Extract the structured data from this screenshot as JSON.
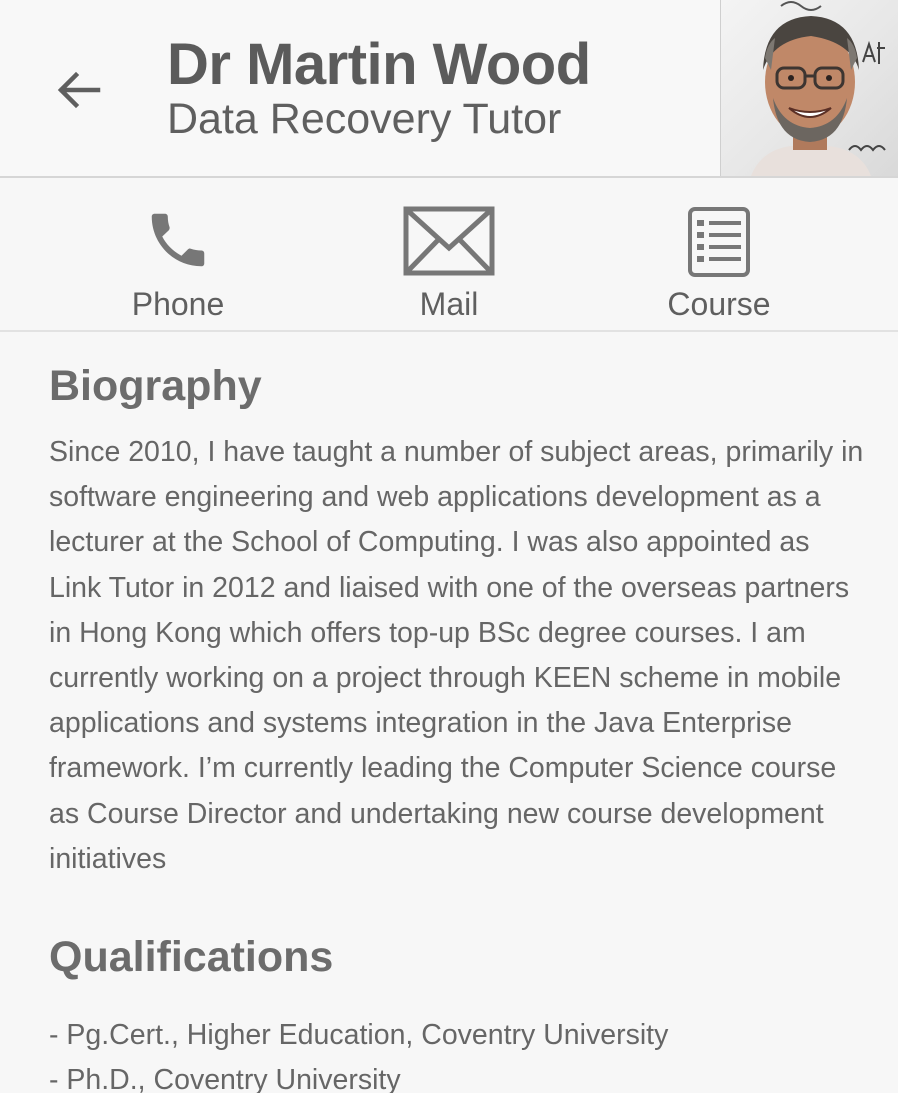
{
  "header": {
    "back_icon": "arrow-left-icon",
    "title": "Dr Martin Wood",
    "subtitle": "Data Recovery Tutor",
    "avatar_description_icon": "profile-photo"
  },
  "actions": [
    {
      "label": "Phone",
      "icon": "phone-icon"
    },
    {
      "label": "Mail",
      "icon": "mail-icon"
    },
    {
      "label": "Course",
      "icon": "course-list-icon"
    }
  ],
  "biography": {
    "heading": "Biography",
    "text": "Since 2010, I have taught a number of subject areas, primarily in software engineering and web applications development as a lecturer at the School of Computing. I was also appointed as Link Tutor in 2012 and liaised with one of the overseas partners in Hong Kong which offers top-up BSc degree courses. I am currently working on a project through KEEN scheme in mobile applications and systems integration in the Java Enterprise framework. I’m currently leading the Computer Science course as Course Director and undertaking new course development initiatives"
  },
  "qualifications": {
    "heading": "Qualifications",
    "items": [
      "- Pg.Cert., Higher Education, Coventry University",
      "- Ph.D., Coventry University"
    ]
  },
  "colors": {
    "text_primary": "#5b5b5b",
    "text_body": "#666666",
    "icon": "#777777",
    "background": "#f7f7f7"
  }
}
